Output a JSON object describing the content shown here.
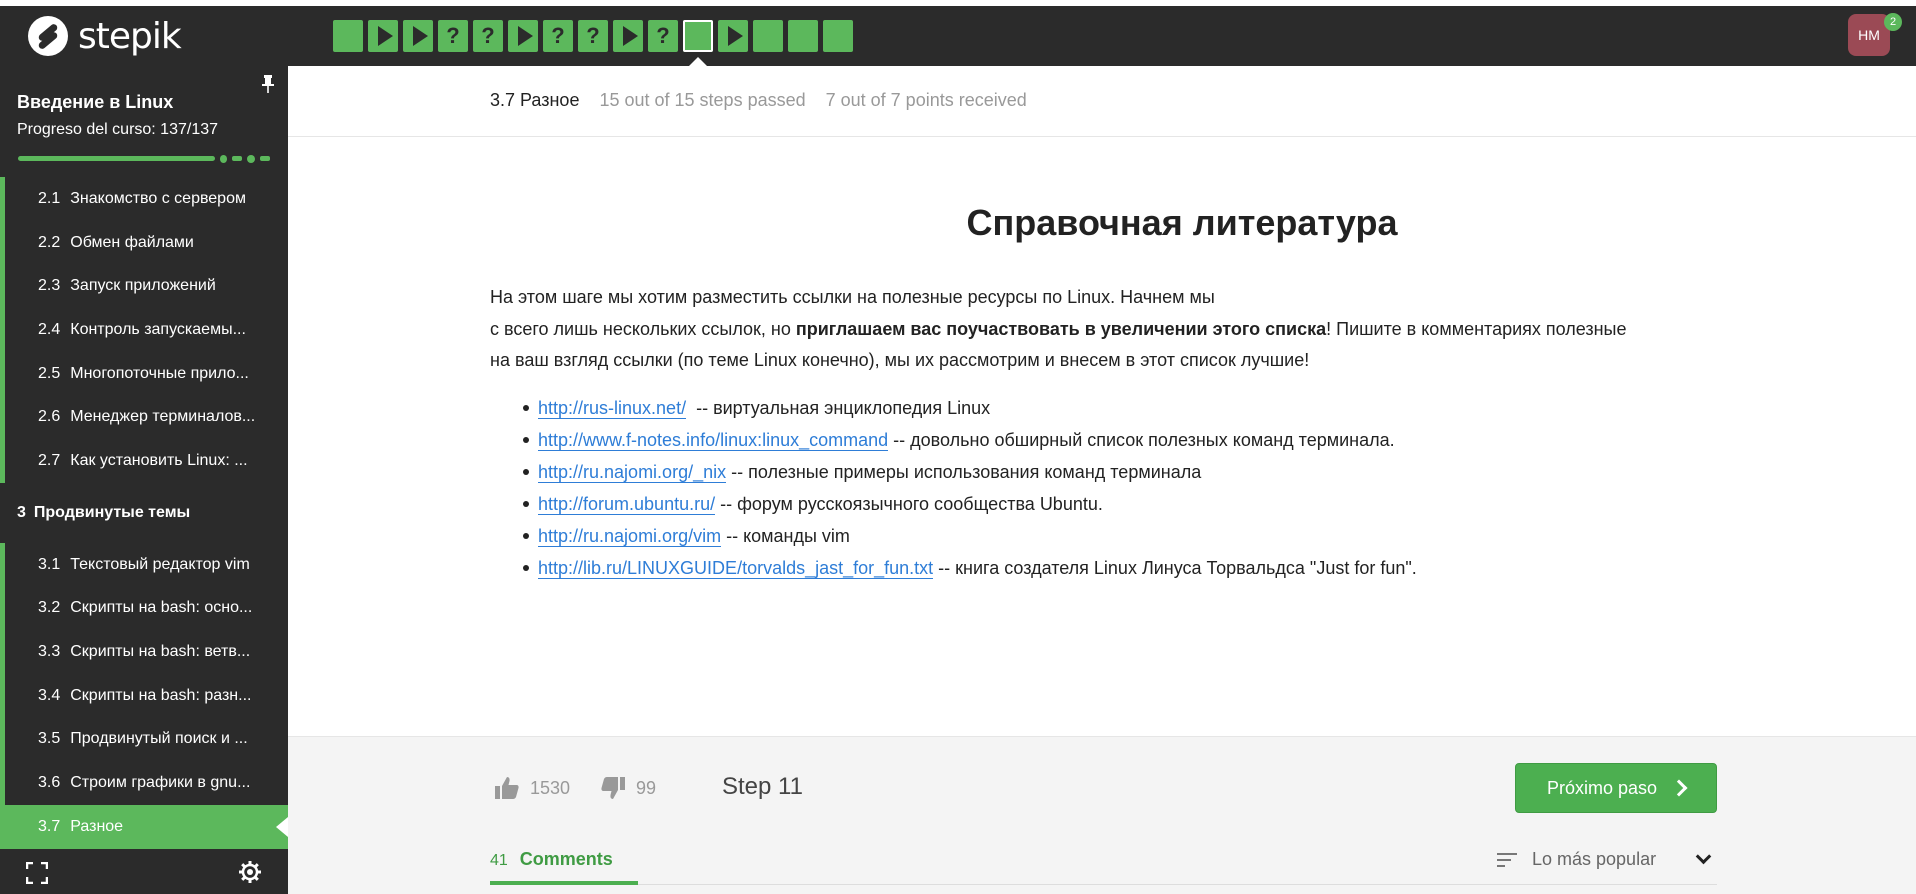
{
  "brand": {
    "name": "stepik"
  },
  "header": {
    "steps": [
      {
        "type": "done"
      },
      {
        "type": "video"
      },
      {
        "type": "video"
      },
      {
        "type": "quiz",
        "glyph": "?"
      },
      {
        "type": "quiz",
        "glyph": "?"
      },
      {
        "type": "video"
      },
      {
        "type": "quiz",
        "glyph": "?"
      },
      {
        "type": "quiz",
        "glyph": "?"
      },
      {
        "type": "video"
      },
      {
        "type": "quiz",
        "glyph": "?"
      },
      {
        "type": "done",
        "active": true
      },
      {
        "type": "video"
      },
      {
        "type": "done"
      },
      {
        "type": "done"
      },
      {
        "type": "done"
      }
    ],
    "user": {
      "initials": "HM",
      "notifications": "2"
    }
  },
  "sidebar": {
    "course_title": "Введение в Linux",
    "progress_label": "Progreso del curso:  137/137",
    "progress_fraction": 1.0,
    "items": [
      {
        "num": "2.1",
        "label": "Знакомство с сервером"
      },
      {
        "num": "2.2",
        "label": "Обмен файлами"
      },
      {
        "num": "2.3",
        "label": "Запуск приложений"
      },
      {
        "num": "2.4",
        "label": "Контроль запускаемы..."
      },
      {
        "num": "2.5",
        "label": "Многопоточные прило..."
      },
      {
        "num": "2.6",
        "label": "Менеджер терминалов..."
      },
      {
        "num": "2.7",
        "label": "Как установить Linux: ..."
      }
    ],
    "section": {
      "num": "3",
      "label": "Продвинутые темы"
    },
    "items2": [
      {
        "num": "3.1",
        "label": "Текстовый редактор vim"
      },
      {
        "num": "3.2",
        "label": "Скрипты на bash: осно..."
      },
      {
        "num": "3.3",
        "label": "Скрипты на bash: ветв..."
      },
      {
        "num": "3.4",
        "label": "Скрипты на bash: разн..."
      },
      {
        "num": "3.5",
        "label": "Продвинутый поиск и ..."
      },
      {
        "num": "3.6",
        "label": "Строим графики в gnu..."
      },
      {
        "num": "3.7",
        "label": "Разное"
      }
    ]
  },
  "main": {
    "lesson_name": "3.7 Разное",
    "steps_passed": "15 out of 15 steps passed",
    "points": "7 out of 7 points  received",
    "title": "Справочная литература",
    "intro_1": "На этом шаге мы хотим разместить ссылки на полезные ресурсы по Linux. Начнем мы",
    "intro_2a": "с всего лишь нескольких ссылок, но ",
    "intro_2b": "приглашаем вас поучаствовать в увеличении этого списка",
    "intro_2c": "! Пишите в комментариях полезные",
    "intro_3": "на ваш взгляд ссылки (по теме Linux конечно), мы их рассмотрим и внесем в этот список лучшие!",
    "links": [
      {
        "url": "http://rus-linux.net/",
        "text": "  -- виртуальная энциклопедия Linux"
      },
      {
        "url": "http://www.f-notes.info/linux:linux_command",
        "text": " -- довольно обширный список полезных команд терминала."
      },
      {
        "url": "http://ru.najomi.org/_nix",
        "text": " -- полезные примеры использования команд терминала"
      },
      {
        "url": "http://forum.ubuntu.ru/",
        "text": " -- форум русскоязычного сообщества Ubuntu."
      },
      {
        "url": "http://ru.najomi.org/vim",
        "text": " -- команды vim"
      },
      {
        "url": "http://lib.ru/LINUXGUIDE/torvalds_jast_for_fun.txt",
        "text": " -- книга создателя Linux Линуса Торвальдса \"Just for fun\"."
      }
    ]
  },
  "footer": {
    "likes": "1530",
    "dislikes": "99",
    "step_label": "Step 11",
    "next_label": "Próximo paso",
    "comments_count": "41",
    "comments_label": "Comments",
    "sort_label": "Lo más popular"
  },
  "colors": {
    "accent": "#5cb85c",
    "dark": "#2b2b2b",
    "link": "#2e7dd7"
  }
}
